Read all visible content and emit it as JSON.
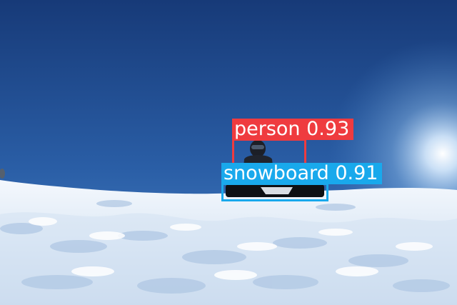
{
  "image": {
    "scene": "snowboarder sitting on a snowy slope under a clear blue sky",
    "colors": {
      "sky_top": "#1a3f80",
      "sky_mid": "#2d66ad",
      "sky_horizon": "#6fa2d8",
      "sun_glow": "#e8f4ff",
      "snow": "#eef4fb",
      "snow_shadow": "#b9cde6"
    }
  },
  "detections": [
    {
      "label": "person",
      "confidence": "0.93",
      "caption": "person 0.93",
      "color": "#ef3b3f"
    },
    {
      "label": "snowboard",
      "confidence": "0.91",
      "caption": "snowboard 0.91",
      "color": "#19a9ec"
    }
  ]
}
